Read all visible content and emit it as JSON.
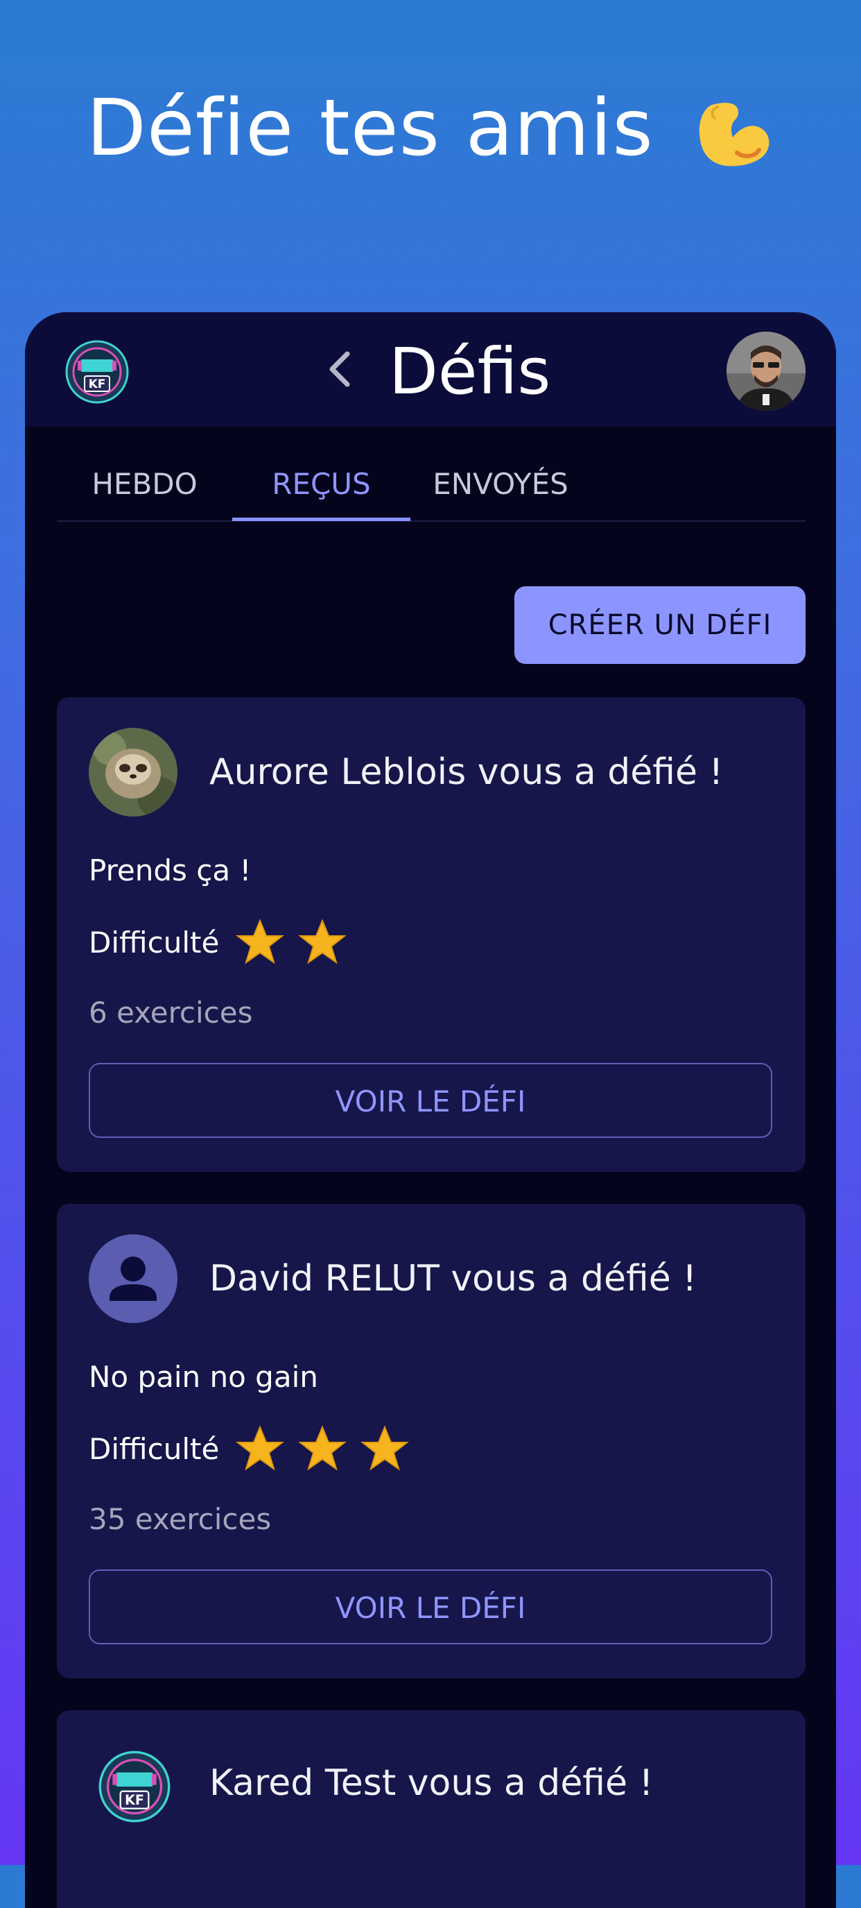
{
  "headline": "Défie tes amis",
  "headline_emoji": "flexed-biceps",
  "appbar": {
    "title": "Défis",
    "logo_text": "KF"
  },
  "tabs": [
    {
      "label": "HEBDO"
    },
    {
      "label": "REÇUS",
      "active": true
    },
    {
      "label": "ENVOYÉS"
    }
  ],
  "create_button": "CRÉER UN DÉFI",
  "challenges": [
    {
      "from": "Aurore Leblois vous a défié !",
      "message": "Prends ça !",
      "difficulty_label": "Difficulté",
      "difficulty": 2,
      "exercises": "6 exercices",
      "button": "VOIR LE DÉFI"
    },
    {
      "from": "David RELUT vous a défié !",
      "message": "No pain no gain",
      "difficulty_label": "Difficulté",
      "difficulty": 3,
      "exercises": "35 exercices",
      "button": "VOIR LE DÉFI"
    },
    {
      "from": "Kared Test vous a défié !"
    }
  ],
  "colors": {
    "accent": "#8c95ff",
    "card": "#16164a",
    "star": "#f6b51e"
  }
}
